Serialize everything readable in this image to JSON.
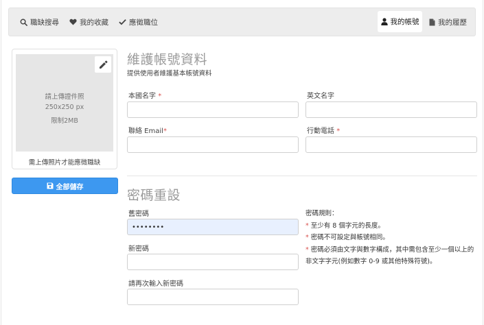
{
  "nav": {
    "left": [
      {
        "label": "職缺搜尋",
        "icon": "search-icon"
      },
      {
        "label": "我的收藏",
        "icon": "heart-icon"
      },
      {
        "label": "應徵職位",
        "icon": "check-icon"
      }
    ],
    "account": {
      "label": "我的帳號",
      "icon": "user-icon"
    },
    "resume": {
      "label": "我的履歷",
      "icon": "document-icon"
    }
  },
  "photo": {
    "line1": "請上傳證件照",
    "line2": "250x250 px",
    "line3": "限制2MB",
    "note": "需上傳照片才能應徵職缺",
    "edit_icon": "pencil-icon"
  },
  "save_all": {
    "label": "全部儲存",
    "icon": "floppy-disk-icon"
  },
  "account_section": {
    "title": "維護帳號資料",
    "subtitle": "提供使用者維護基本帳號資料",
    "fields": {
      "chinese_name": {
        "label": "本國名字",
        "required": "*",
        "value": ""
      },
      "english_name": {
        "label": "英文名字",
        "value": ""
      },
      "email": {
        "label": "聯絡 Email",
        "required": "*",
        "value": ""
      },
      "mobile": {
        "label": "行動電話",
        "required": "*",
        "value": ""
      }
    }
  },
  "password_section": {
    "title": "密碼重設",
    "old_password": {
      "label": "舊密碼",
      "value": "••••••••"
    },
    "new_password": {
      "label": "新密碼",
      "value": ""
    },
    "confirm_password": {
      "label": "請再次輸入新密碼",
      "value": ""
    },
    "rules_title": "密碼規則：",
    "rules": [
      "至少有 8 個字元的長度。",
      "密碼不可設定與帳號相同。",
      "密碼必須由文字與數字構成，其中需包含至少一個以上的"
    ],
    "rules_continuation": "非文字字元(例如數字 0-9 或其他特殊符號)。",
    "rule_marker": "*"
  },
  "colors": {
    "primary": "#3d98f0",
    "required": "#d9534f",
    "autofill": "#e8f0fe",
    "nav_bg": "#ededed"
  }
}
